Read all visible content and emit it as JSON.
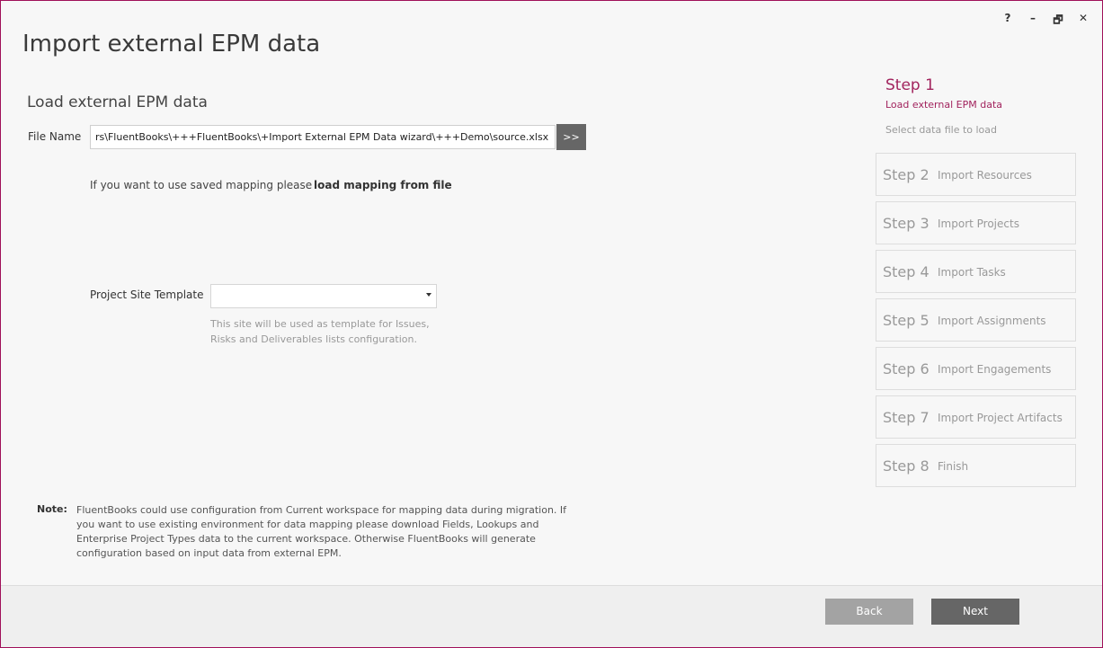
{
  "window": {
    "title": "Import external EPM data",
    "controls": {
      "help": "?",
      "minimize": "–",
      "restore": "🗗",
      "close": "✕"
    }
  },
  "main": {
    "section_title": "Load external EPM data",
    "file_name_label": "File Name",
    "file_name_value": "rs\\FluentBooks\\+++FluentBooks\\+Import External EPM Data wizard\\+++Demo\\source.xlsx",
    "browse_label": ">>",
    "mapping_text": "If you want to use saved mapping please",
    "mapping_link": "load mapping from file",
    "project_site_template_label": "Project Site Template",
    "project_site_template_value": "",
    "project_site_template_help": "This site will be used as template for Issues, Risks and Deliverables lists configuration.",
    "note_label": "Note:",
    "note_text": "FluentBooks could use configuration from Current workspace for mapping data during migration. If you want to use existing environment for data mapping please download Fields, Lookups and Enterprise Project Types data to the current workspace. Otherwise FluentBooks will generate configuration based on input data from external EPM."
  },
  "steps": {
    "current": {
      "title": "Step 1",
      "subtitle": "Load external EPM data",
      "description": "Select data file to load"
    },
    "items": [
      {
        "num": "Step 2",
        "name": "Import Resources"
      },
      {
        "num": "Step 3",
        "name": "Import Projects"
      },
      {
        "num": "Step 4",
        "name": "Import Tasks"
      },
      {
        "num": "Step 5",
        "name": "Import Assignments"
      },
      {
        "num": "Step 6",
        "name": "Import Engagements"
      },
      {
        "num": "Step 7",
        "name": "Import Project Artifacts"
      },
      {
        "num": "Step 8",
        "name": "Finish"
      }
    ]
  },
  "footer": {
    "back_label": "Back",
    "next_label": "Next"
  },
  "colors": {
    "accent": "#a2245e",
    "border": "#a0105a",
    "button_dark": "#666666",
    "button_light": "#a3a3a3"
  }
}
